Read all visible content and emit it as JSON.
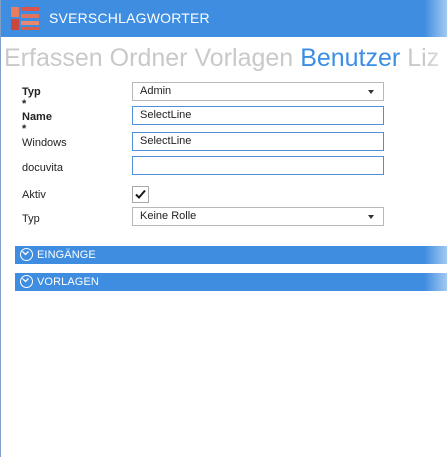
{
  "window": {
    "title": "SVERSCHLAGWORTER"
  },
  "tabs": [
    {
      "label": "Erfassen",
      "active": false
    },
    {
      "label": "Ordner",
      "active": false
    },
    {
      "label": "Vorlagen",
      "active": false
    },
    {
      "label": "Benutzer",
      "active": true
    },
    {
      "label": "Liz",
      "active": false
    }
  ],
  "form": {
    "typ1": {
      "label": "Typ *",
      "value": "Admin"
    },
    "name": {
      "label": "Name *",
      "value": "SelectLine"
    },
    "windows": {
      "label": "Windows",
      "value": "SelectLine"
    },
    "docuvita": {
      "label": "docuvita",
      "value": ""
    },
    "aktiv": {
      "label": "Aktiv",
      "checked": true
    },
    "typ2": {
      "label": "Typ",
      "value": "Keine Rolle"
    }
  },
  "sections": [
    {
      "label": "EINGÄNGE"
    },
    {
      "label": "VORLAGEN"
    }
  ],
  "colors": {
    "accent": "#3e8de0",
    "tab_active": "#3c8ee5",
    "tab_inactive": "#c9c9c9"
  }
}
